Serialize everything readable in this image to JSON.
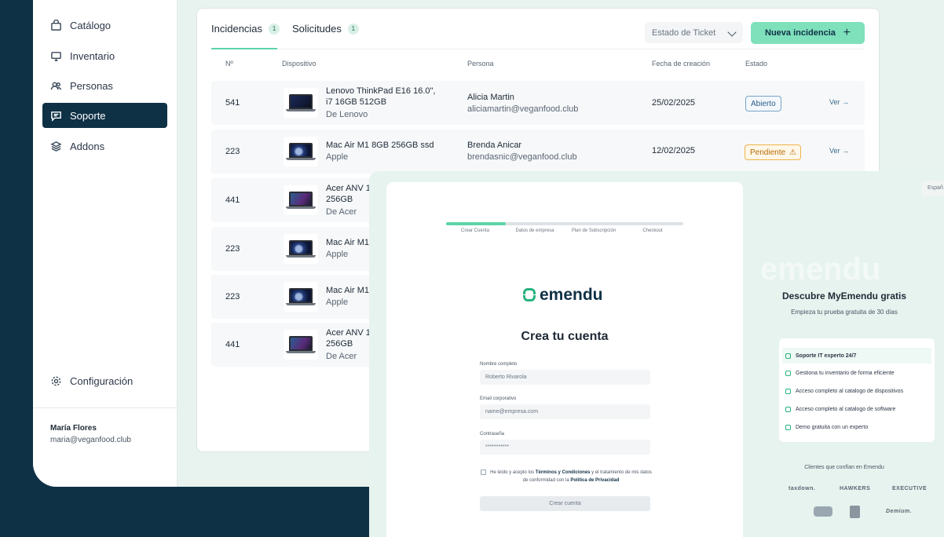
{
  "sidebar": {
    "items": [
      {
        "label": "Catálogo",
        "icon": "bag-icon"
      },
      {
        "label": "Inventario",
        "icon": "monitor-icon"
      },
      {
        "label": "Personas",
        "icon": "people-icon"
      },
      {
        "label": "Soporte",
        "icon": "chat-icon",
        "active": true
      },
      {
        "label": "Addons",
        "icon": "layers-icon"
      }
    ],
    "settings_label": "Configuración",
    "user": {
      "name": "María Flores",
      "email": "maria@veganfood.club"
    }
  },
  "tabs": [
    {
      "label": "Incidencias",
      "count": "1"
    },
    {
      "label": "Solicitudes",
      "count": "1"
    }
  ],
  "toolbar": {
    "filter_label": "Estado de Ticket",
    "new_button": "Nueva incidencia",
    "new_button_icon": "+"
  },
  "table": {
    "headers": [
      "Nº",
      "Dispositivo",
      "Persona",
      "Fecha de creación",
      "Estado"
    ],
    "action_label": "Ver →",
    "rows": [
      {
        "id": "541",
        "device": "Lenovo ThinkPad E16 16.0\",",
        "device2": "i7 16GB 512GB",
        "brand": "De Lenovo",
        "person": "Alicia Martin",
        "email": "aliciamartin@veganfood.club",
        "date": "25/02/2025",
        "status": "Abierto"
      },
      {
        "id": "223",
        "device": "Mac Air M1 8GB 256GB ssd",
        "brand": "Apple",
        "person": "Brenda Anicar",
        "email": "brendasnic@veganfood.club",
        "date": "12/02/2025",
        "status": "Pendiente"
      },
      {
        "id": "441",
        "device": "Acer ANV 1",
        "device2": "256GB",
        "brand": "De Acer"
      },
      {
        "id": "223",
        "device": "Mac Air M1",
        "brand": "Apple"
      },
      {
        "id": "223",
        "device": "Mac Air M1",
        "brand": "Apple"
      },
      {
        "id": "441",
        "device": "Acer ANV 1",
        "device2": "256GB",
        "brand": "De Acer"
      }
    ]
  },
  "signup": {
    "steps": [
      "Crear Cuenta",
      "Datos de empresa",
      "Plan de Subscripción",
      "Checkout"
    ],
    "progress_fraction": 0.25,
    "logo_text": "emendu",
    "title": "Crea tu cuenta",
    "fields": [
      {
        "label": "Nombre completo",
        "value": "Roberto Rivarola"
      },
      {
        "label": "Email corporativo",
        "placeholder": "name@empresa.com"
      },
      {
        "label": "Contraseña",
        "value": "***********"
      }
    ],
    "terms_prefix": "He leído y acepto los ",
    "terms_link": "Términos y Condiciones",
    "terms_mid": " y el tratamiento de mis datos de conformidad con la ",
    "privacy_link": "Política de Privacidad",
    "submit_label": "Crear cuenta"
  },
  "promo": {
    "language": "Españ",
    "watermark": "emendu",
    "title": "Descubre MyEmendu gratis",
    "subtitle": "Empieza tu prueba gratuita de 30 días",
    "features": [
      "Soporte IT experto 24/7",
      "Gestiona tu inventario de forma eficiente",
      "Acceso completo al catalogo de dispositivos",
      "Acceso completo al catalogo de software",
      "Demo gratuita con un experto"
    ],
    "clients_title": "Clientes que confían en Emendu",
    "clients": [
      "taxdown.",
      "HAWKERS",
      "EXECUTIVE",
      "",
      "",
      "Demium."
    ]
  },
  "colors": {
    "primary_dark": "#0f3146",
    "accent_green": "#5fd3a8",
    "status_open": "#2d5f8a",
    "status_pending": "#b56b00"
  }
}
